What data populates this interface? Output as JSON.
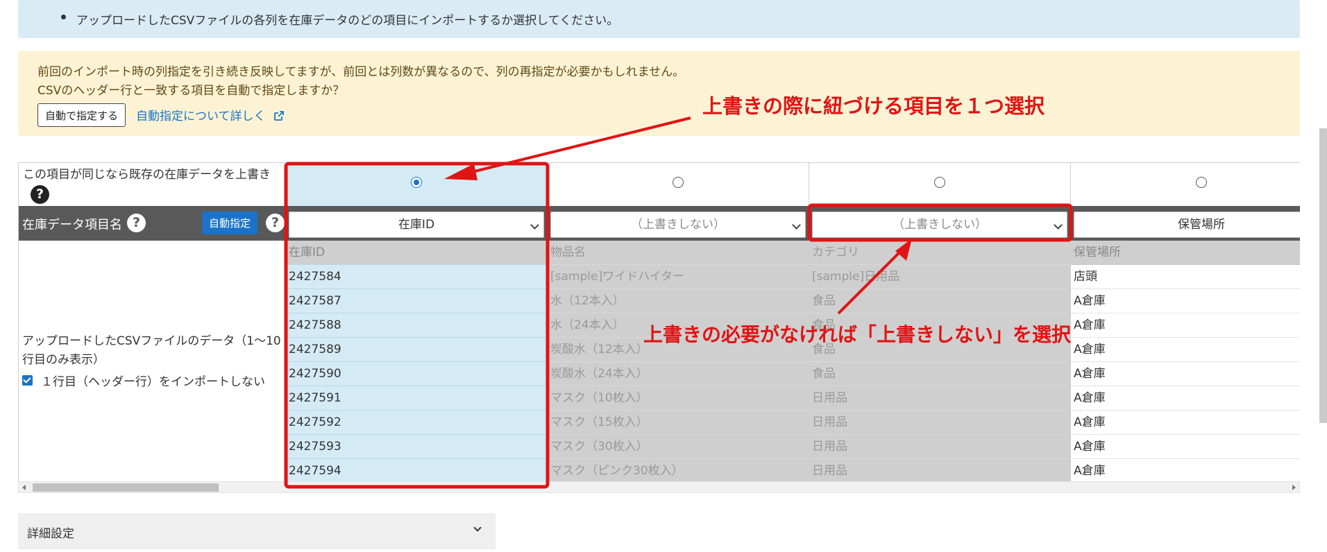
{
  "info": {
    "text": "アップロードしたCSVファイルの各列を在庫データのどの項目にインポートするか選択してください。"
  },
  "warning": {
    "line1": "前回のインポート時の列指定を引き続き反映してますが、前回とは列数が異なるので、列の再指定が必要かもしれません。",
    "line2": "CSVのヘッダー行と一致する項目を自動で指定しますか？",
    "auto_button": "自動で指定する",
    "auto_link": "自動指定について詳しく"
  },
  "labels": {
    "overwrite": "この項目が同じなら既存の在庫データを上書き",
    "item_name": "在庫データ項目名",
    "auto_spec": "自動指定",
    "data_preview": "アップロードしたCSVファイルのデータ（1〜10行目のみ表示）",
    "skip_header": "１行目（ヘッダー行）をインポートしない",
    "question": "?"
  },
  "columns": [
    {
      "select": "在庫ID",
      "rows": [
        "在庫ID",
        "2427584",
        "2427587",
        "2427588",
        "2427589",
        "2427590",
        "2427591",
        "2427592",
        "2427593",
        "2427594"
      ]
    },
    {
      "select": "（上書きしない）",
      "rows": [
        "物品名",
        "[sample]ワイドハイター",
        "水（12本入）",
        "水（24本入）",
        "炭酸水（12本入）",
        "炭酸水（24本入）",
        "マスク（10枚入）",
        "マスク（15枚入）",
        "マスク（30枚入）",
        "マスク（ピンク30枚入）"
      ]
    },
    {
      "select": "（上書きしない）",
      "rows": [
        "カテゴリ",
        "[sample]日用品",
        "食品",
        "食品",
        "食品",
        "食品",
        "日用品",
        "日用品",
        "日用品",
        "日用品"
      ]
    },
    {
      "select": "保管場所",
      "rows": [
        "保管場所",
        "店頭",
        "A倉庫",
        "A倉庫",
        "A倉庫",
        "A倉庫",
        "A倉庫",
        "A倉庫",
        "A倉庫",
        "A倉庫"
      ]
    }
  ],
  "details": {
    "title": "詳細設定"
  },
  "annotations": {
    "top": "上書きの際に紐づける項目を１つ選択",
    "bottom": "上書きの必要がなければ「上書きしない」を選択"
  },
  "colors": {
    "annotation": "#e01414",
    "accent": "#1a73c8",
    "header_bg": "#595959"
  }
}
